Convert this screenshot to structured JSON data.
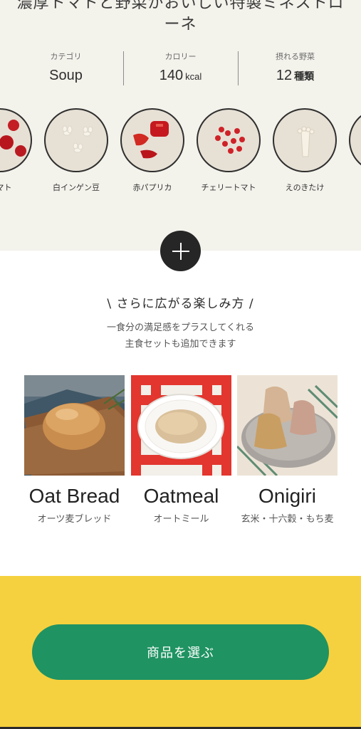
{
  "header": {
    "title_line1": "濃厚トマトと野菜がおいしい特製ミネストロ",
    "title_line2": "ーネ"
  },
  "stats": [
    {
      "label": "カテゴリ",
      "value": "Soup",
      "unit": ""
    },
    {
      "label": "カロリー",
      "value": "140",
      "unit": "kcal"
    },
    {
      "label": "摂れる野菜",
      "value": "12",
      "unit": "種類"
    }
  ],
  "vegetables": [
    {
      "label": "トマト",
      "icon": "tomato-icon"
    },
    {
      "label": "白インゲン豆",
      "icon": "white-bean-icon"
    },
    {
      "label": "赤パプリカ",
      "icon": "red-paprika-icon"
    },
    {
      "label": "チェリートマト",
      "icon": "cherry-tomato-icon"
    },
    {
      "label": "えのきたけ",
      "icon": "enoki-icon"
    }
  ],
  "more": {
    "heading": "\\ さらに広がる楽しみ方 /",
    "sub_line1": "一食分の満足感をプラスしてくれる",
    "sub_line2": "主食セットも追加できます"
  },
  "staples": [
    {
      "name": "Oat Bread",
      "sub": "オーツ麦ブレッド"
    },
    {
      "name": "Oatmeal",
      "sub": "オートミール"
    },
    {
      "name": "Onigiri",
      "sub": "玄米・十六穀・もち麦"
    }
  ],
  "cta": {
    "label": "商品を選ぶ"
  },
  "colors": {
    "top_bg": "#f3f2eb",
    "cta_band": "#f6d13f",
    "cta_button": "#1f9362"
  }
}
